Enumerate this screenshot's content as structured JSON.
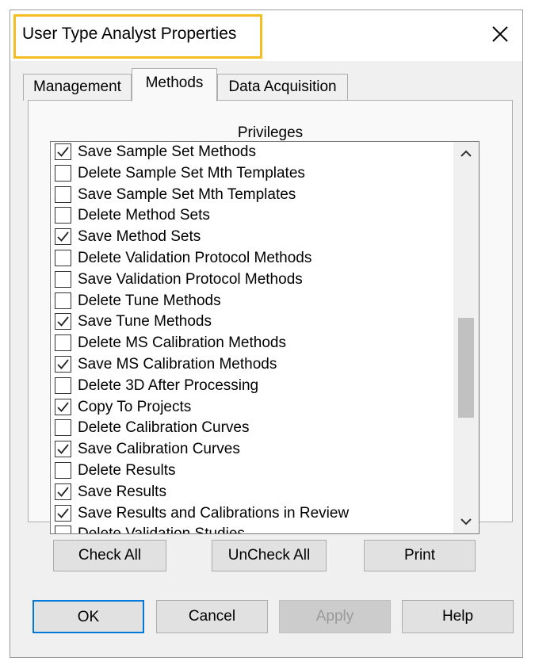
{
  "dialog": {
    "title": "User Type Analyst Properties",
    "close_icon": "close-icon"
  },
  "tabs": [
    {
      "label": "Management",
      "active": false
    },
    {
      "label": "Methods",
      "active": true
    },
    {
      "label": "Data Acquisition",
      "active": false
    }
  ],
  "privileges": {
    "header": "Privileges",
    "items": [
      {
        "label": "Save Sample Set Methods",
        "checked": true
      },
      {
        "label": "Delete Sample Set Mth Templates",
        "checked": false
      },
      {
        "label": "Save Sample Set Mth Templates",
        "checked": false
      },
      {
        "label": "Delete Method Sets",
        "checked": false
      },
      {
        "label": "Save Method Sets",
        "checked": true
      },
      {
        "label": "Delete Validation Protocol Methods",
        "checked": false
      },
      {
        "label": "Save Validation Protocol Methods",
        "checked": false
      },
      {
        "label": "Delete Tune Methods",
        "checked": false
      },
      {
        "label": "Save Tune Methods",
        "checked": true
      },
      {
        "label": "Delete MS Calibration Methods",
        "checked": false
      },
      {
        "label": "Save MS Calibration Methods",
        "checked": true
      },
      {
        "label": "Delete 3D After Processing",
        "checked": false
      },
      {
        "label": "Copy To Projects",
        "checked": true
      },
      {
        "label": "Delete Calibration Curves",
        "checked": false
      },
      {
        "label": "Save Calibration Curves",
        "checked": true
      },
      {
        "label": "Delete Results",
        "checked": false
      },
      {
        "label": "Save Results",
        "checked": true
      },
      {
        "label": "Save Results and Calibrations in Review",
        "checked": true
      },
      {
        "label": "Delete Validation Studies",
        "checked": false
      }
    ],
    "scroll_up_icon": "chevron-up-icon",
    "scroll_down_icon": "chevron-down-icon"
  },
  "actions": {
    "check_all": "Check All",
    "uncheck_all": "UnCheck All",
    "print": "Print"
  },
  "footer": {
    "ok": "OK",
    "cancel": "Cancel",
    "apply": "Apply",
    "help": "Help"
  }
}
